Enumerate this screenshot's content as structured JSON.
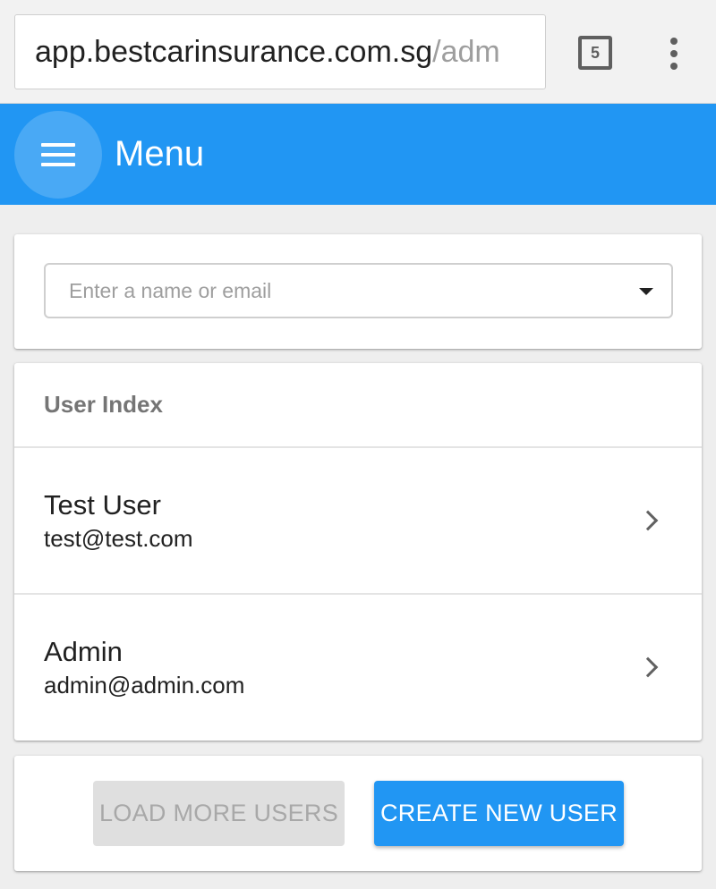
{
  "browser": {
    "url_host": "app.bestcarinsurance.com.sg",
    "url_path": "/adm",
    "tab_count": "5",
    "overflow_icon": "vertical-dots-icon"
  },
  "app_bar": {
    "menu_icon": "hamburger-icon",
    "title": "Menu",
    "color": "#2196f3"
  },
  "search": {
    "placeholder": "Enter a name or email",
    "value": ""
  },
  "users": {
    "header": "User Index",
    "items": [
      {
        "name": "Test User",
        "email": "test@test.com"
      },
      {
        "name": "Admin",
        "email": "admin@admin.com"
      }
    ]
  },
  "actions": {
    "load_more_label": "LOAD MORE USERS",
    "create_label": "CREATE NEW USER"
  }
}
